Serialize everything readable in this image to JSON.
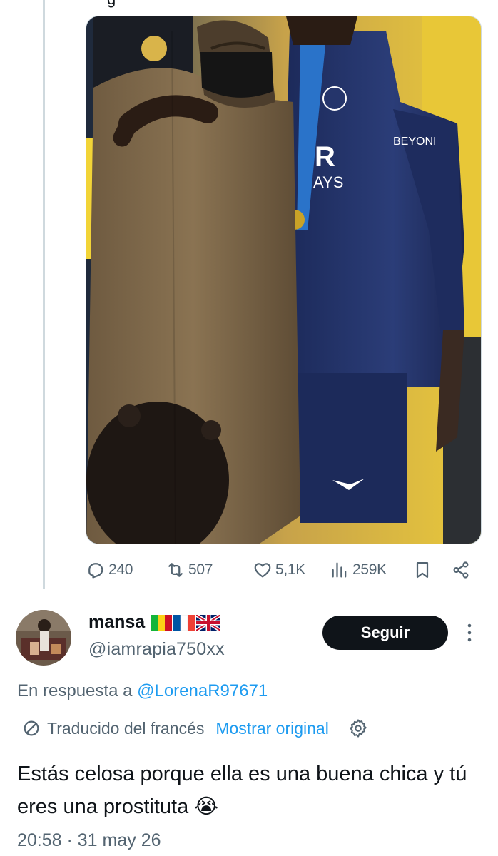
{
  "original_tweet": {
    "truncated_text": "g",
    "stats": {
      "replies": "240",
      "reposts": "507",
      "likes": "5,1K",
      "views": "259K"
    },
    "icons": [
      "reply-icon",
      "repost-icon",
      "like-icon",
      "views-icon",
      "bookmark-icon",
      "share-icon"
    ]
  },
  "reply": {
    "display_name": "mansa",
    "flags": [
      "mali-flag",
      "france-flag",
      "uk-flag"
    ],
    "handle": "@iamrapia750xx",
    "follow_label": "Seguir",
    "reply_prefix": "En respuesta a",
    "reply_mention": "@LorenaR97671",
    "translated_label": "Traducido del francés",
    "show_original_label": "Mostrar original",
    "text": "Estás celosa porque ella es una buena chica y tú eres una prostituta 😭",
    "timestamp": "20:58 · 31 may 26"
  },
  "colors": {
    "text_primary": "#0f1419",
    "text_secondary": "#536471",
    "link": "#1d9bf0",
    "follow_bg": "#0f1419",
    "thread_line": "#cfd9de"
  }
}
